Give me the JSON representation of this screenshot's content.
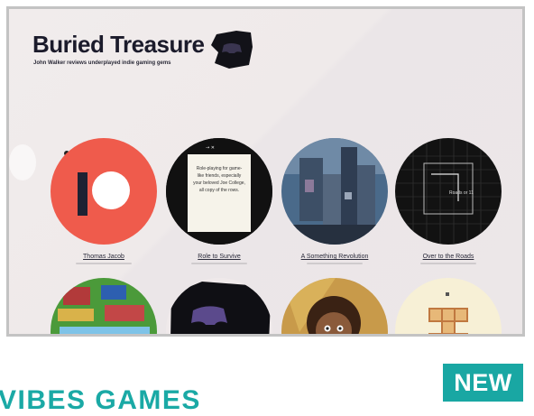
{
  "site": {
    "title": "Buried Treasure",
    "tagline": "John Walker reviews underplayed indie gaming gems"
  },
  "games": [
    {
      "title": "Thomas Jacob",
      "art": "patreon-icon"
    },
    {
      "title": "Role to Survive",
      "art": "text-card",
      "card_text": "Role-playing for game-like friends, especially your beloved Joe College, all copy of the rows."
    },
    {
      "title": "A Something Revolution",
      "art": "pixel-cityscape"
    },
    {
      "title": "Over to the Roads",
      "art": "grid-map",
      "map_label": "Roads or 11"
    },
    {
      "title": "",
      "art": "pixel-village"
    },
    {
      "title": "",
      "art": "controller-blob"
    },
    {
      "title": "",
      "art": "cartoon-girl"
    },
    {
      "title": "",
      "art": "block-puzzle"
    }
  ],
  "badge": {
    "label": "NEW"
  },
  "section": {
    "heading": "VIBES GAMES"
  },
  "colors": {
    "accent": "#19a7a3",
    "patreon": "#ef5b4c"
  }
}
